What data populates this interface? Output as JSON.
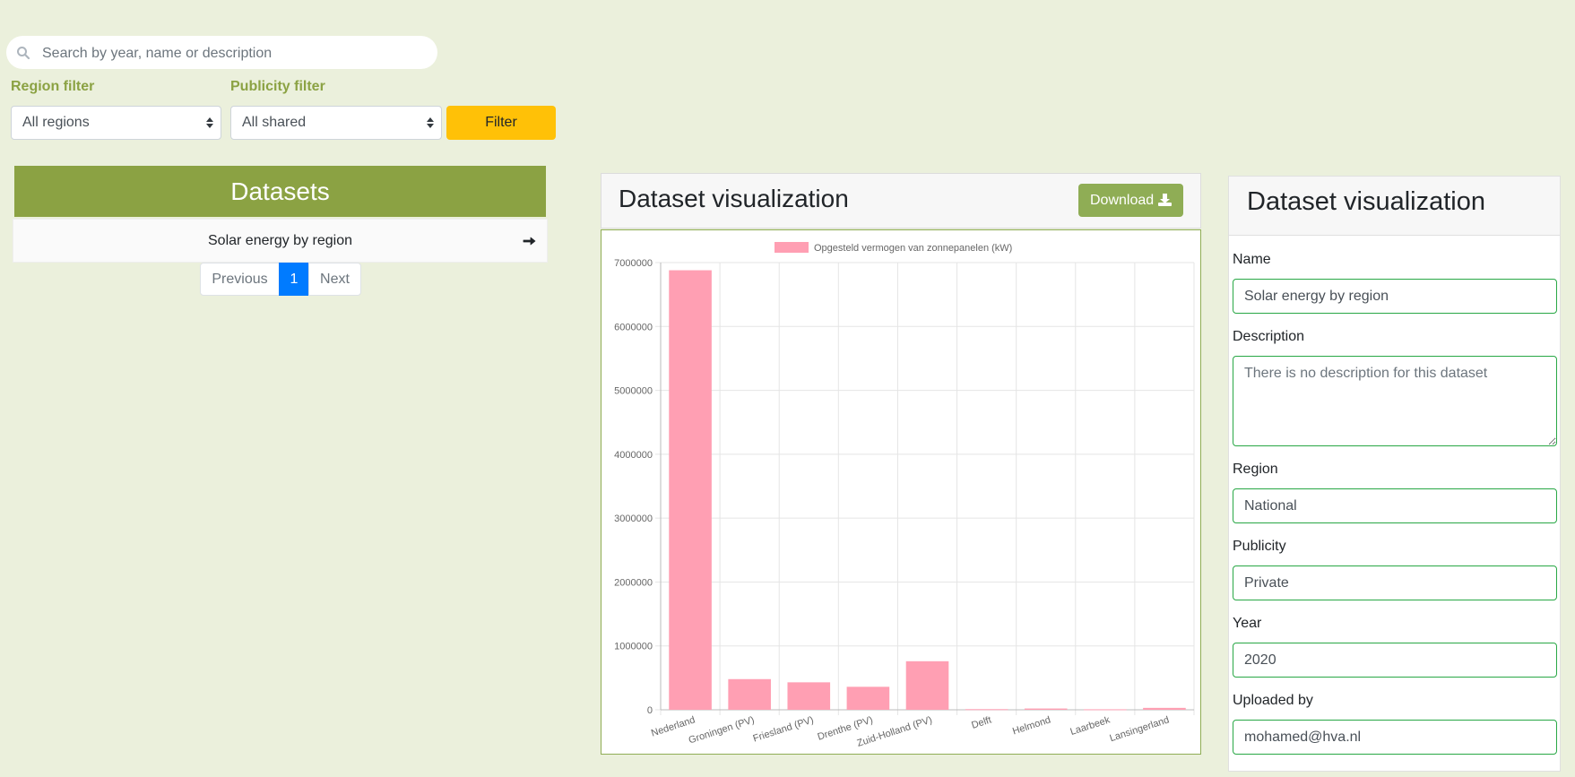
{
  "search": {
    "placeholder": "Search by year, name or description"
  },
  "filters": {
    "region_label": "Region filter",
    "region_value": "All regions",
    "publicity_label": "Publicity filter",
    "publicity_value": "All shared",
    "filter_button": "Filter"
  },
  "datasets": {
    "title": "Datasets",
    "items": [
      {
        "label": "Solar energy by region"
      }
    ],
    "pagination": {
      "previous": "Previous",
      "current": "1",
      "next": "Next"
    }
  },
  "visualization": {
    "title": "Dataset visualization",
    "download_label": "Download"
  },
  "chart_data": {
    "type": "bar",
    "title": "",
    "legend": "Opgesteld vermogen van zonnepanelen (kW)",
    "legend_position": "top",
    "categories": [
      "Nederland",
      "Groningen (PV)",
      "Friesland (PV)",
      "Drenthe (PV)",
      "Zuid-Holland (PV)",
      "Delft",
      "Helmond",
      "Laarbeek",
      "Lansingerland"
    ],
    "values": [
      6880000,
      480000,
      430000,
      360000,
      760000,
      10000,
      20000,
      8000,
      30000
    ],
    "ylim": [
      0,
      7000000
    ],
    "yticks": [
      0,
      1000000,
      2000000,
      3000000,
      4000000,
      5000000,
      6000000,
      7000000
    ],
    "grid": true,
    "bar_color": "#ff9fb3"
  },
  "details": {
    "title": "Dataset visualization",
    "name_label": "Name",
    "name_value": "Solar energy by region",
    "description_label": "Description",
    "description_placeholder": "There is no description for this dataset",
    "region_label": "Region",
    "region_value": "National",
    "publicity_label": "Publicity",
    "publicity_value": "Private",
    "year_label": "Year",
    "year_value": "2020",
    "uploaded_label": "Uploaded by",
    "uploaded_value": "mohamed@hva.nl"
  },
  "icons": {
    "search": "search-icon",
    "caret": "caret-updown-icon",
    "arrow": "arrow-right-icon",
    "download": "download-icon"
  }
}
